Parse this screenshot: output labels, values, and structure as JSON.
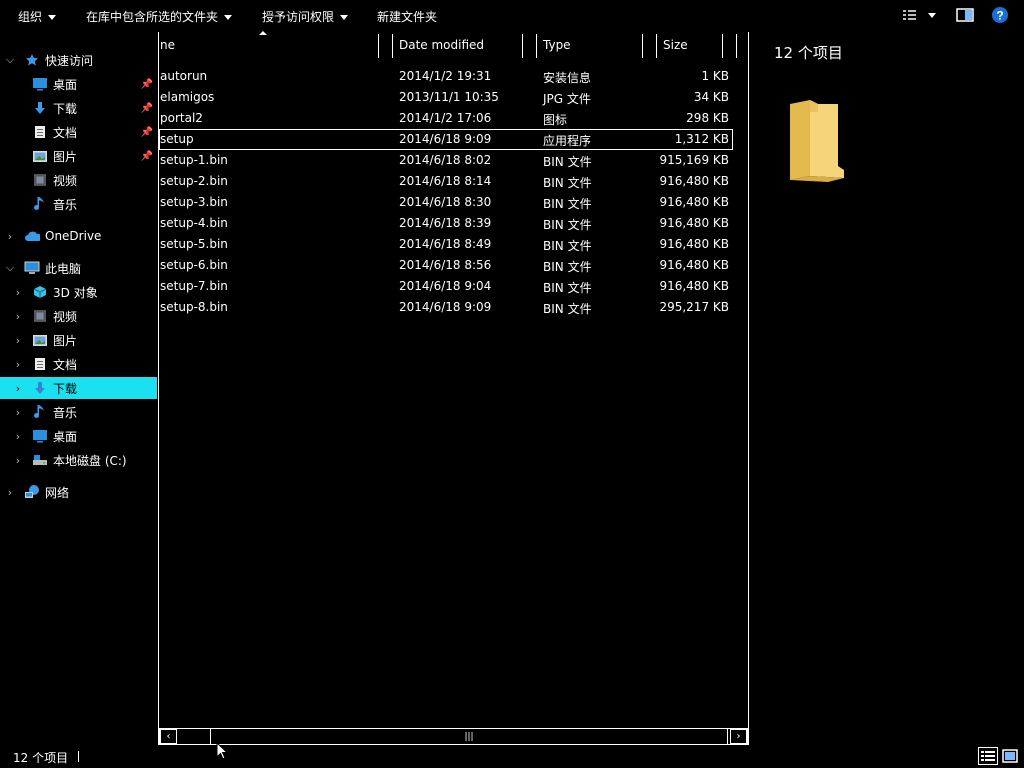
{
  "toolbar": {
    "organize": "组织",
    "include_in_library": "在库中包含所选的文件夹",
    "grant_access": "授予访问权限",
    "new_folder": "新建文件夹"
  },
  "nav": {
    "quick_access": "快速访问",
    "qa_items": [
      "桌面",
      "下载",
      "文档",
      "图片",
      "视频",
      "音乐"
    ],
    "onedrive": "OneDrive",
    "this_pc": "此电脑",
    "pc_items": [
      "3D 对象",
      "视频",
      "图片",
      "文档",
      "下载",
      "音乐",
      "桌面",
      "本地磁盘 (C:)"
    ],
    "network": "网络",
    "selected": "下载"
  },
  "columns": {
    "name": "ne",
    "date": "Date modified",
    "type": "Type",
    "size": "Size"
  },
  "files": [
    {
      "name": "autorun",
      "date": "2014/1/2 19:31",
      "type": "安装信息",
      "size": "1 KB"
    },
    {
      "name": "elamigos",
      "date": "2013/11/1 10:35",
      "type": "JPG 文件",
      "size": "34 KB"
    },
    {
      "name": "portal2",
      "date": "2014/1/2 17:06",
      "type": "图标",
      "size": "298 KB"
    },
    {
      "name": "setup",
      "date": "2014/6/18 9:09",
      "type": "应用程序",
      "size": "1,312 KB"
    },
    {
      "name": "setup-1.bin",
      "date": "2014/6/18 8:02",
      "type": "BIN 文件",
      "size": "915,169 KB"
    },
    {
      "name": "setup-2.bin",
      "date": "2014/6/18 8:14",
      "type": "BIN 文件",
      "size": "916,480 KB"
    },
    {
      "name": "setup-3.bin",
      "date": "2014/6/18 8:30",
      "type": "BIN 文件",
      "size": "916,480 KB"
    },
    {
      "name": "setup-4.bin",
      "date": "2014/6/18 8:39",
      "type": "BIN 文件",
      "size": "916,480 KB"
    },
    {
      "name": "setup-5.bin",
      "date": "2014/6/18 8:49",
      "type": "BIN 文件",
      "size": "916,480 KB"
    },
    {
      "name": "setup-6.bin",
      "date": "2014/6/18 8:56",
      "type": "BIN 文件",
      "size": "916,480 KB"
    },
    {
      "name": "setup-7.bin",
      "date": "2014/6/18 9:04",
      "type": "BIN 文件",
      "size": "916,480 KB"
    },
    {
      "name": "setup-8.bin",
      "date": "2014/6/18 9:09",
      "type": "BIN 文件",
      "size": "295,217 KB"
    }
  ],
  "preview": {
    "title": "12 个项目"
  },
  "status": {
    "item_count": "12 个项目"
  },
  "colors": {
    "background": "#000000",
    "selection": "#1ae0f0",
    "folder": "#f5d47a"
  }
}
